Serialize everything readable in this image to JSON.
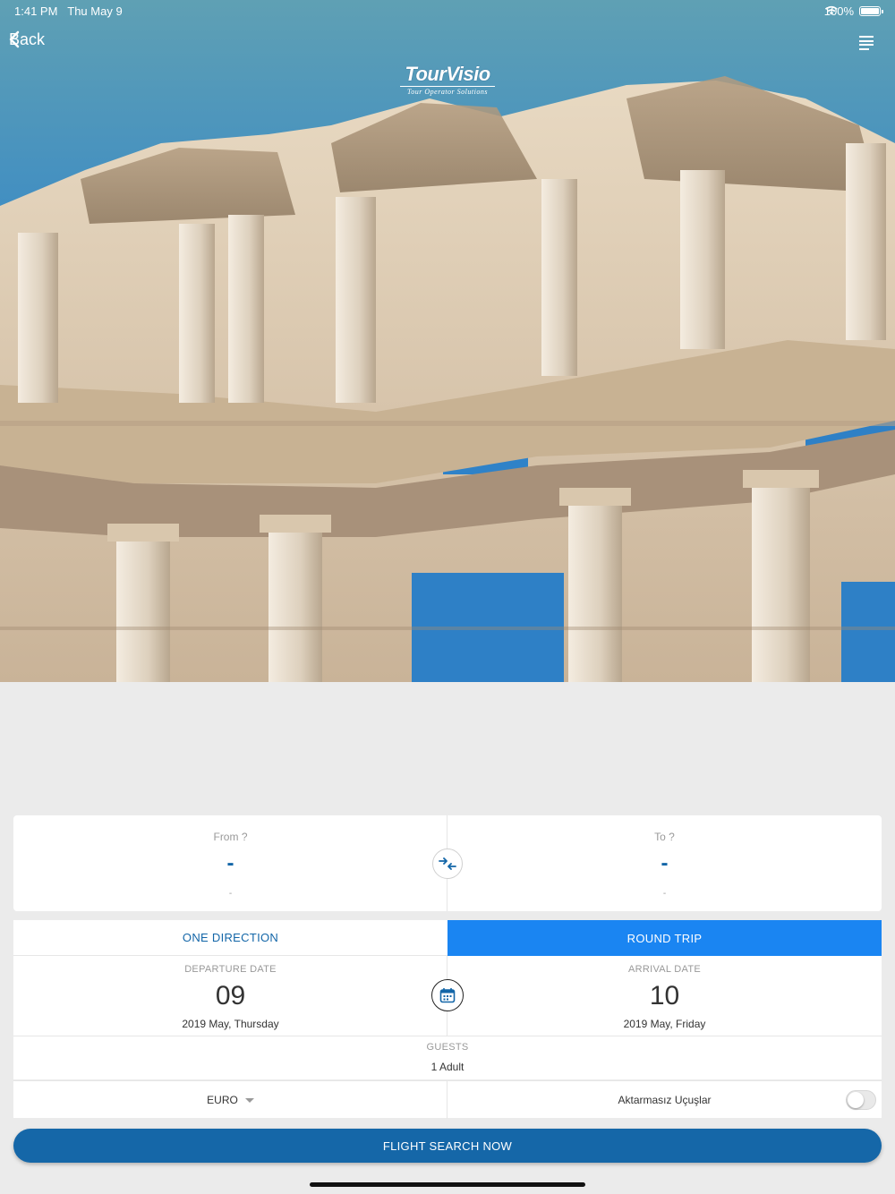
{
  "status_bar": {
    "time": "1:41 PM",
    "date": "Thu May 9",
    "battery": "100%"
  },
  "nav": {
    "back_label": "Back"
  },
  "logo": {
    "brand": "TourVisio",
    "tagline": "Tour Operator Solutions"
  },
  "route": {
    "from_label": "From ?",
    "from_code": "-",
    "from_sub": "-",
    "to_label": "To ?",
    "to_code": "-",
    "to_sub": "-"
  },
  "trip_type": {
    "one_direction": "ONE DIRECTION",
    "round_trip": "ROUND TRIP",
    "selected": "round_trip"
  },
  "dates": {
    "departure_label": "DEPARTURE DATE",
    "departure_day": "09",
    "departure_sub": "2019 May, Thursday",
    "arrival_label": "ARRIVAL DATE",
    "arrival_day": "10",
    "arrival_sub": "2019 May, Friday"
  },
  "guests": {
    "label": "GUESTS",
    "value": "1 Adult"
  },
  "options": {
    "currency": "EURO",
    "nonstop_label": "Aktarmasız Uçuşlar",
    "nonstop_enabled": false
  },
  "search_button": "FLIGHT SEARCH NOW",
  "colors": {
    "primary": "#1567a8",
    "accent": "#1a85f2",
    "background": "#ebebeb"
  }
}
